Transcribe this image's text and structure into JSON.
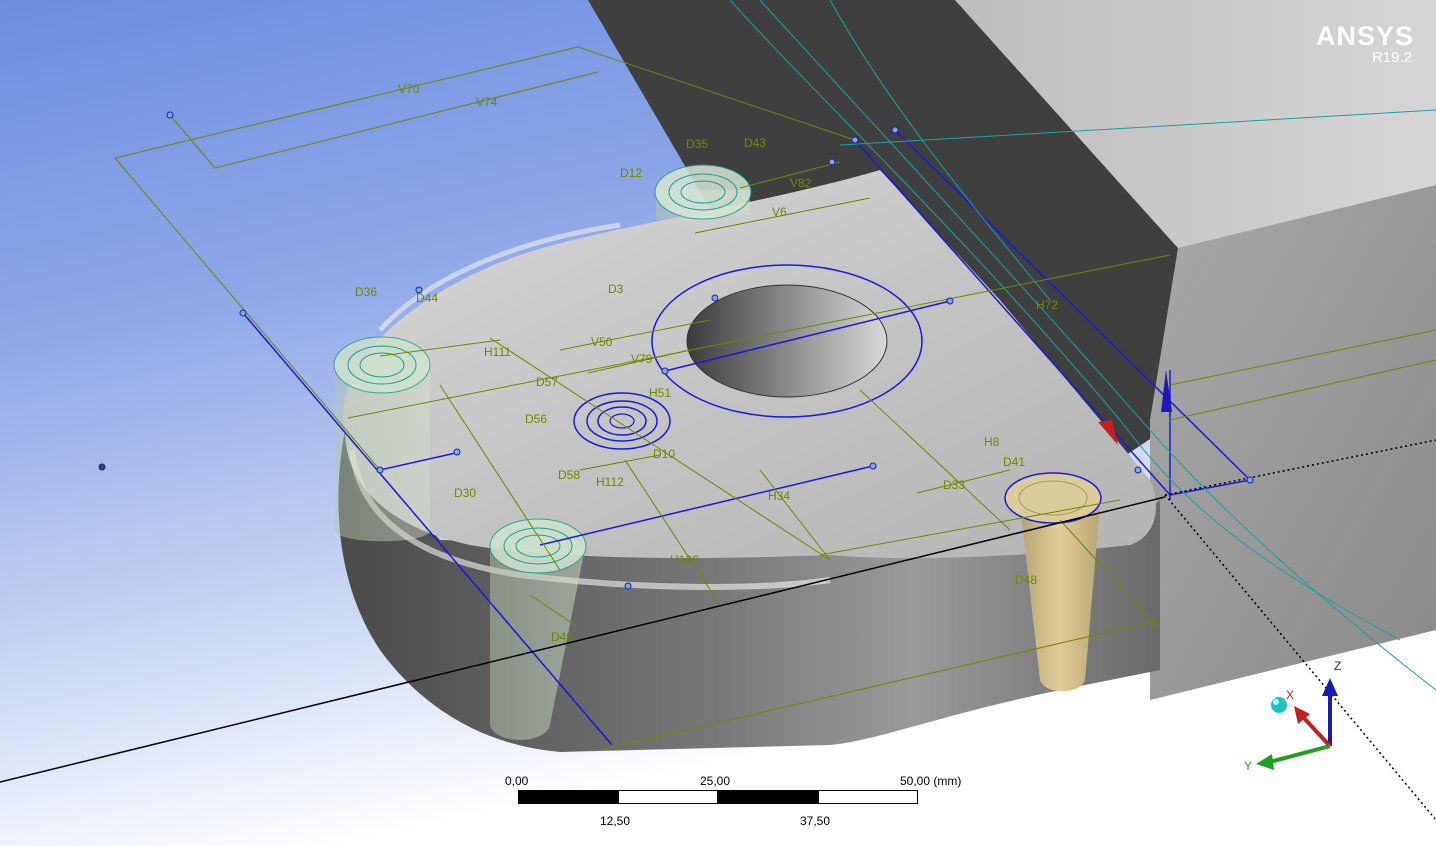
{
  "logo": {
    "brand": "ANSYS",
    "version": "R19.2"
  },
  "dimensions": [
    "V70",
    "V74",
    "D35",
    "D43",
    "D12",
    "V82",
    "V6",
    "D3",
    "D36",
    "D44",
    "H111",
    "V50",
    "V79",
    "D57",
    "H51",
    "D56",
    "D10",
    "D58",
    "H112",
    "H34",
    "D30",
    "H106",
    "D49",
    "D33",
    "D41",
    "H8",
    "H72",
    "D48"
  ],
  "scale_bar": {
    "top_labels": [
      "0,00",
      "25,00",
      "50,00 (mm)"
    ],
    "bottom_labels": [
      "12,50",
      "37,50"
    ]
  },
  "triad": {
    "x_label": "X",
    "y_label": "Y",
    "z_label": "Z"
  },
  "colors": {
    "background_top": "#6d8ee0",
    "part_face": "#c8c8c8",
    "part_side": "#5a5a5a",
    "sketch_blue": "#1a1ad8",
    "dimension_green": "#6c8a00",
    "axis_x": "#c02020",
    "axis_y": "#20a020",
    "axis_z": "#1a1ab0"
  }
}
